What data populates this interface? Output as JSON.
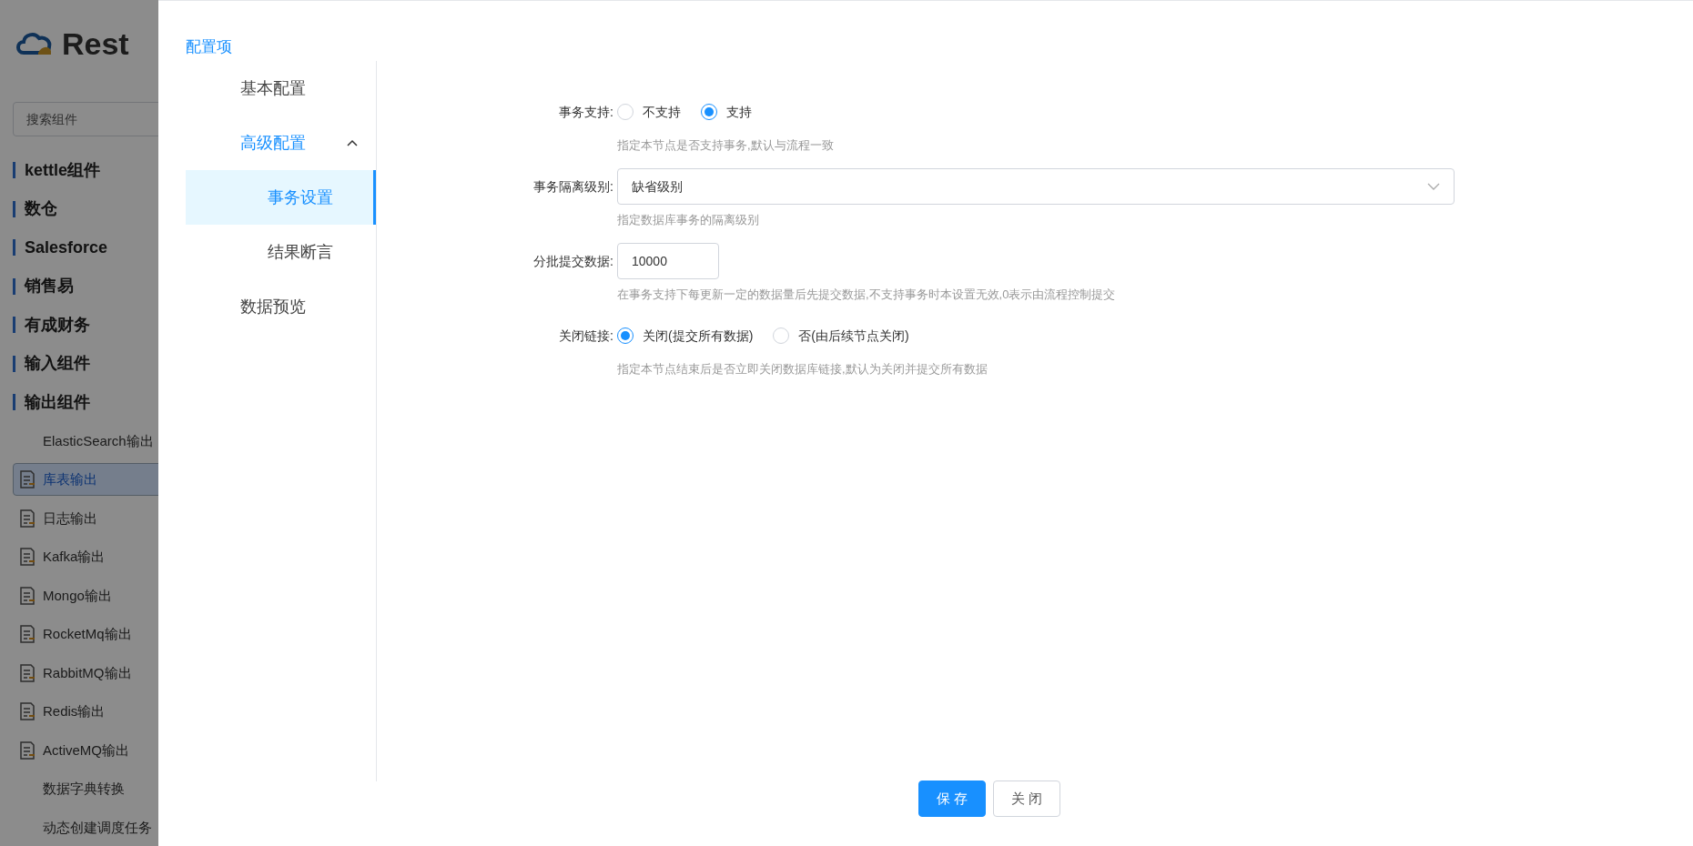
{
  "app": {
    "logo_text": "Rest",
    "search": {
      "placeholder": "搜索组件"
    },
    "items": [
      {
        "kind": "category",
        "label": "kettle组件"
      },
      {
        "kind": "category",
        "label": "数仓"
      },
      {
        "kind": "category",
        "label": "Salesforce"
      },
      {
        "kind": "category",
        "label": "销售易"
      },
      {
        "kind": "category",
        "label": "有成财务"
      },
      {
        "kind": "category",
        "label": "输入组件"
      },
      {
        "kind": "category",
        "label": "输出组件"
      },
      {
        "kind": "plain",
        "label": "ElasticSearch输出",
        "selected": false
      },
      {
        "kind": "component",
        "label": "库表输出",
        "selected": true
      },
      {
        "kind": "component",
        "label": "日志输出",
        "selected": false
      },
      {
        "kind": "component",
        "label": "Kafka输出",
        "selected": false
      },
      {
        "kind": "component",
        "label": "Mongo输出",
        "selected": false
      },
      {
        "kind": "component",
        "label": "RocketMq输出",
        "selected": false
      },
      {
        "kind": "component",
        "label": "RabbitMQ输出",
        "selected": false
      },
      {
        "kind": "component",
        "label": "Redis输出",
        "selected": false
      },
      {
        "kind": "component",
        "label": "ActiveMQ输出",
        "selected": false
      },
      {
        "kind": "plain",
        "label": "数据字典转换",
        "selected": false
      },
      {
        "kind": "plain",
        "label": "动态创建调度任务",
        "selected": false
      }
    ]
  },
  "drawer": {
    "title": "配置项",
    "nav": [
      {
        "label": "基本配置",
        "selected": false
      },
      {
        "label": "高级配置",
        "selected": false,
        "expanded": true,
        "children": [
          {
            "label": "事务设置",
            "selected": true
          },
          {
            "label": "结果断言",
            "selected": false
          }
        ]
      },
      {
        "label": "数据预览",
        "selected": false
      }
    ],
    "form": [
      {
        "kind": "radio",
        "label": "事务支持:",
        "options": [
          {
            "label": "不支持",
            "selected": false
          },
          {
            "label": "支持",
            "selected": true
          }
        ],
        "hint": "指定本节点是否支持事务,默认与流程一致"
      },
      {
        "kind": "select",
        "label": "事务隔离级别:",
        "value": "缺省级别",
        "hint": "指定数据库事务的隔离级别"
      },
      {
        "kind": "input",
        "label": "分批提交数据:",
        "value": "10000",
        "hint": "在事务支持下每更新一定的数据量后先提交数据,不支持事务时本设置无效,0表示由流程控制提交"
      },
      {
        "kind": "radio",
        "label": "关闭链接:",
        "options": [
          {
            "label": "关闭(提交所有数据)",
            "selected": true
          },
          {
            "label": "否(由后续节点关闭)",
            "selected": false
          }
        ],
        "hint": "指定本节点结束后是否立即关闭数据库链接,默认为关闭并提交所有数据"
      }
    ],
    "buttons": [
      {
        "label": "保 存",
        "kind": "primary"
      },
      {
        "label": "关 闭",
        "kind": "default"
      }
    ]
  }
}
